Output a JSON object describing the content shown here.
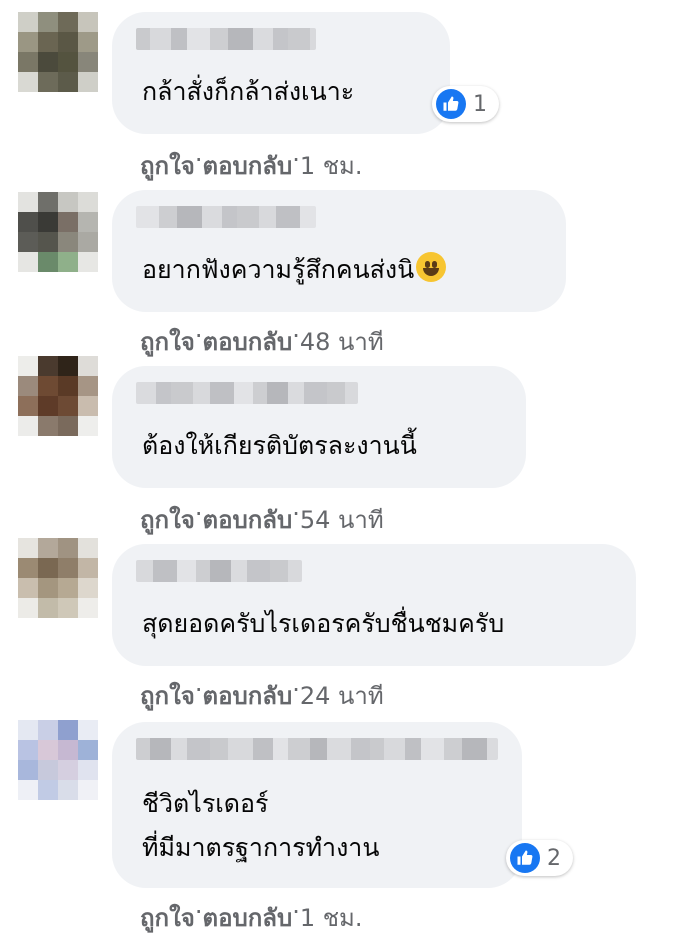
{
  "like_label": "ถูกใจ",
  "reply_label": "ตอบกลับ",
  "separator": " · ",
  "comments": [
    {
      "lines": [
        "กล้าสั่งก็กล้าส่งเนาะ"
      ],
      "time": "1 ชม.",
      "reaction_count": "1",
      "avatar_colors": [
        "#cfcfc7",
        "#8f8f7e",
        "#6e6a58",
        "#c7c5bb",
        "#9a9683",
        "#6a6552",
        "#5a5745",
        "#9e9a88",
        "#7a7766",
        "#4b4a3c",
        "#54533f",
        "#88867a",
        "#d9d9d3",
        "#6d6b5a",
        "#5c5b4a",
        "#cfcfc8"
      ]
    },
    {
      "lines": [
        "อยากฟังความรู้สึกคนส่งนิ"
      ],
      "time": "48 นาที",
      "emoji": "grinning-face",
      "avatar_colors": [
        "#e3e3e0",
        "#6f6f6a",
        "#c7c7c2",
        "#dcdcd8",
        "#4f4f4b",
        "#3a3a36",
        "#7a6f66",
        "#b5b5b0",
        "#5c5c57",
        "#55554d",
        "#8a877c",
        "#aaa9a3",
        "#e6e6e3",
        "#6a8a6a",
        "#8fb08a",
        "#e7e7e4"
      ]
    },
    {
      "lines": [
        "ต้องให้เกียรติบัตรละงานนี้"
      ],
      "time": "54 นาที",
      "avatar_colors": [
        "#ededea",
        "#4a3a2e",
        "#2f2419",
        "#dedcd8",
        "#9b8a7c",
        "#6e4a33",
        "#5a3a26",
        "#a69585",
        "#8d6f5a",
        "#5e3b28",
        "#6d4a34",
        "#c9bcae",
        "#ececea",
        "#8a7a6c",
        "#7a6a5c",
        "#eeeeec"
      ]
    },
    {
      "lines": [
        "สุดยอดครับไรเดอรครับชื่นชมครับ"
      ],
      "time": "24 นาที",
      "avatar_colors": [
        "#e6e4df",
        "#b3a89a",
        "#a09382",
        "#e3e1dc",
        "#9b8a73",
        "#7a6852",
        "#8f7e69",
        "#c2b6a6",
        "#c9beae",
        "#a4967f",
        "#b6a993",
        "#ddd7cd",
        "#ecebe7",
        "#c2bba9",
        "#cfc8b8",
        "#eeedea"
      ]
    },
    {
      "lines": [
        "ชีวิตไรเดอร์",
        "ที่มีมาตรฐาการทำงาน"
      ],
      "time": "1 ชม.",
      "reaction_count": "2",
      "avatar_colors": [
        "#e4e8f2",
        "#c9cfe6",
        "#8fa0cf",
        "#e9ecf4",
        "#b9c3e3",
        "#d8c8d8",
        "#c6b8d2",
        "#9eb2d8",
        "#a8b7dc",
        "#c7c9dc",
        "#d5cfe0",
        "#e0e3ef",
        "#eef0f6",
        "#c1cbe5",
        "#d9dde9",
        "#f0f1f6"
      ]
    }
  ]
}
